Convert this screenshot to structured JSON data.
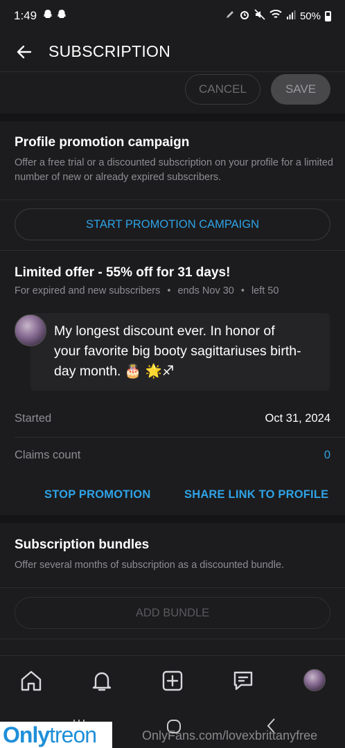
{
  "status_bar": {
    "time": "1:49",
    "battery": "50%",
    "icons": [
      "snapchat-icon",
      "snapchat-icon",
      "pencil-icon",
      "alarm-icon",
      "mute-icon",
      "wifi-icon",
      "signal-icon",
      "battery-icon"
    ]
  },
  "header": {
    "title": "SUBSCRIPTION"
  },
  "actions": {
    "cancel_label": "CANCEL",
    "save_label": "SAVE"
  },
  "promotion": {
    "title": "Profile promotion campaign",
    "description": "Offer a free trial or a discounted subscription on your profile for a limited number of new or already expired subscribers.",
    "start_button": "START PROMOTION CAMPAIGN"
  },
  "offer": {
    "title": "Limited offer - 55% off for 31 days!",
    "audience": "For expired and new subscribers",
    "separator": "•",
    "ends": "ends Nov 30",
    "left": "left 50",
    "message_line1": "My longest discount ever. In honor of",
    "message_line2": "your favorite big booty sagittariuses birth-",
    "message_line3": "day month. 🎂 🌟♐",
    "started_label": "Started",
    "started_value": "Oct 31, 2024",
    "claims_label": "Claims count",
    "claims_value": "0",
    "stop_label": "STOP PROMOTION",
    "share_label": "SHARE LINK TO PROFILE"
  },
  "bundles": {
    "title": "Subscription bundles",
    "description": "Offer several months of subscription as a discounted bundle.",
    "add_label": "ADD BUNDLE"
  },
  "bottom_nav": [
    "home-icon",
    "bell-icon",
    "add-post-icon",
    "messages-icon",
    "profile-avatar"
  ],
  "watermark": {
    "brand_a": "Only",
    "brand_b": "treon",
    "url": "OnlyFans.com/lovexbrittanyfree"
  }
}
